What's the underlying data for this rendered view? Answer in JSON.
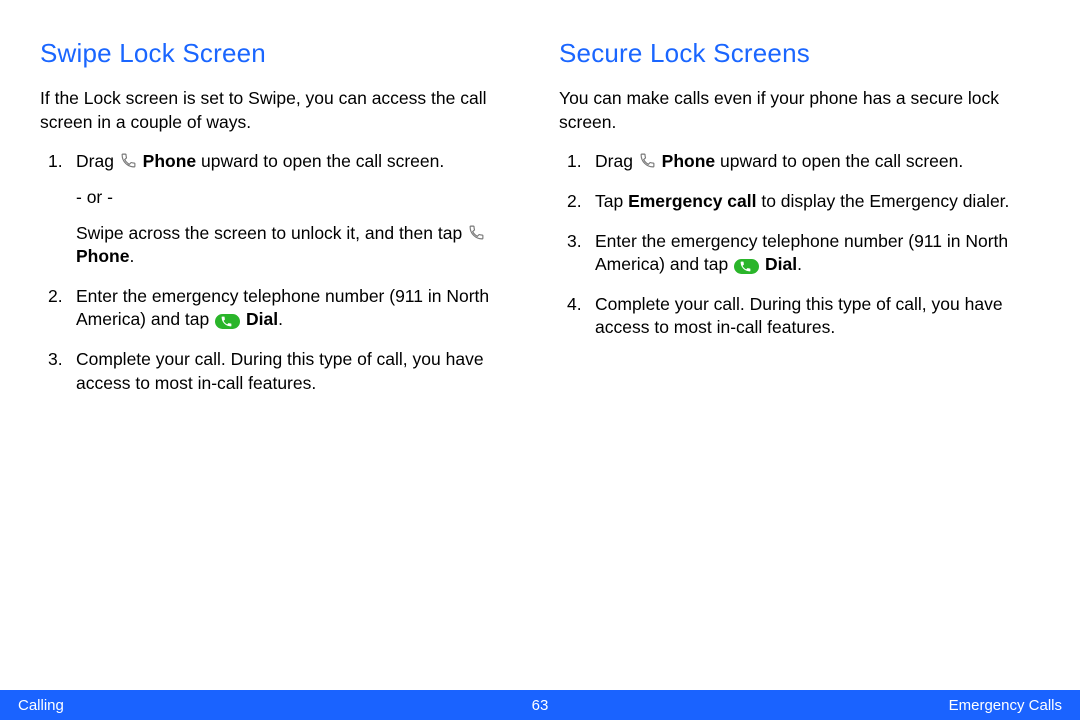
{
  "left": {
    "heading": "Swipe Lock Screen",
    "intro": "If the Lock screen is set to Swipe, you can access the call screen in a couple of ways.",
    "step1a": "Drag ",
    "step1_phone": "Phone",
    "step1b": " upward to open the call screen.",
    "or": "- or -",
    "step1c": "Swipe across the screen to unlock it, and then tap ",
    "step1_phone2": "Phone",
    "step1d": ".",
    "step2a": "Enter the emergency telephone number (911 in North America) and tap ",
    "step2_dial": "Dial",
    "step2b": ".",
    "step3": "Complete your call. During this type of call, you have access to most in-call features."
  },
  "right": {
    "heading": "Secure Lock Screens",
    "intro": "You can make calls even if your phone has a secure lock screen.",
    "step1a": "Drag ",
    "step1_phone": "Phone",
    "step1b": " upward to open the call screen.",
    "step2a": "Tap ",
    "step2_em": "Emergency call",
    "step2b": " to display the Emergency dialer.",
    "step3a": "Enter the emergency telephone number (911 in North America) and tap ",
    "step3_dial": "Dial",
    "step3b": ".",
    "step4": "Complete your call. During this type of call, you have access to most in-call features."
  },
  "footer": {
    "left": "Calling",
    "center": "63",
    "right": "Emergency Calls"
  }
}
